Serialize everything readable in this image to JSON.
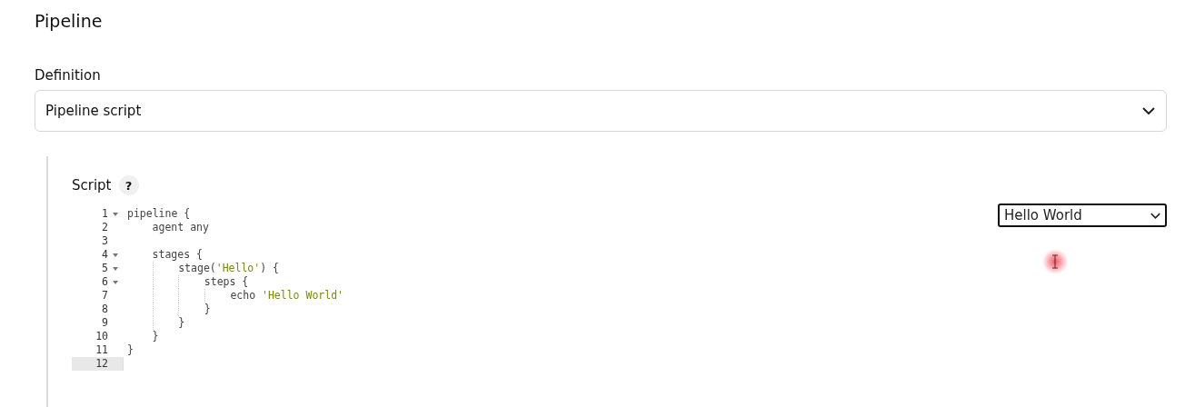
{
  "section_title": "Pipeline",
  "definition": {
    "label": "Definition",
    "value": "Pipeline script"
  },
  "script": {
    "label": "Script",
    "help": "?",
    "lines": [
      {
        "number": "1",
        "foldable": true,
        "active": false,
        "segments": [
          {
            "kind": "plain",
            "text": "pipeline {"
          }
        ]
      },
      {
        "number": "2",
        "foldable": false,
        "active": false,
        "segments": [
          {
            "kind": "plain",
            "text": "    agent any"
          }
        ]
      },
      {
        "number": "3",
        "foldable": false,
        "active": false
      },
      {
        "number": "4",
        "foldable": true,
        "active": false,
        "segments": [
          {
            "kind": "plain",
            "text": "    stages {"
          }
        ]
      },
      {
        "number": "5",
        "foldable": true,
        "active": false,
        "segments": [
          {
            "kind": "plain",
            "text": "        stage("
          },
          {
            "kind": "string",
            "text": "'Hello'"
          },
          {
            "kind": "plain",
            "text": ") {"
          }
        ]
      },
      {
        "number": "6",
        "foldable": true,
        "active": false,
        "segments": [
          {
            "kind": "plain",
            "text": "            steps {"
          }
        ]
      },
      {
        "number": "7",
        "foldable": false,
        "active": false,
        "segments": [
          {
            "kind": "plain",
            "text": "                echo "
          },
          {
            "kind": "string",
            "text": "'Hello World'"
          }
        ]
      },
      {
        "number": "8",
        "foldable": false,
        "active": false,
        "segments": [
          {
            "kind": "plain",
            "text": "            }"
          }
        ]
      },
      {
        "number": "9",
        "foldable": false,
        "active": false,
        "segments": [
          {
            "kind": "plain",
            "text": "        }"
          }
        ]
      },
      {
        "number": "10",
        "foldable": false,
        "active": false,
        "segments": [
          {
            "kind": "plain",
            "text": "    }"
          }
        ]
      },
      {
        "number": "11",
        "foldable": false,
        "active": false,
        "segments": [
          {
            "kind": "plain",
            "text": "}"
          }
        ]
      },
      {
        "number": "12",
        "foldable": false,
        "active": true
      }
    ],
    "sample": {
      "value": "Hello World"
    }
  }
}
